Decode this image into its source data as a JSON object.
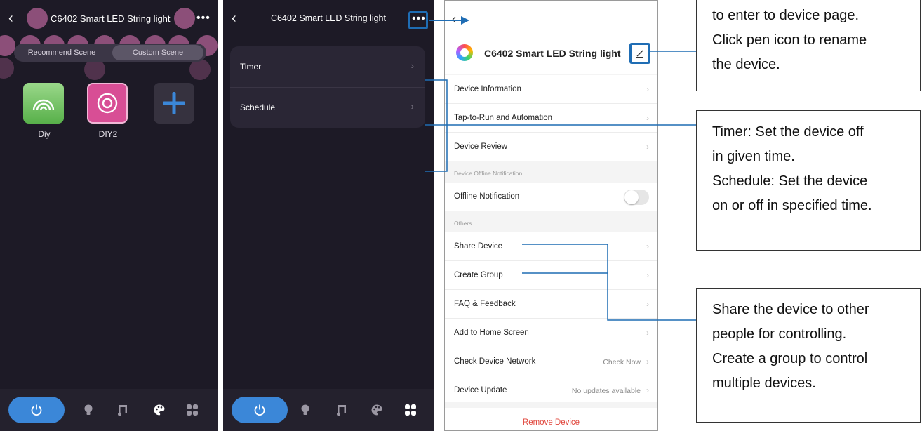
{
  "scene_screen": {
    "title": "C6402 Smart LED String light",
    "tabs": {
      "recommend": "Recommend Scene",
      "custom": "Custom Scene"
    },
    "scenes": [
      {
        "name": "Diy",
        "icon": "rainbow-icon"
      },
      {
        "name": "DIY2",
        "icon": "target-icon"
      }
    ],
    "add_icon": "plus-icon",
    "bottom_tabs": [
      "power-icon",
      "bulb-icon",
      "music-icon",
      "palette-icon",
      "grid-icon"
    ],
    "active_tab": "power-icon"
  },
  "timer_screen": {
    "title": "C6402 Smart LED String light",
    "menu": [
      {
        "label": "Timer"
      },
      {
        "label": "Schedule"
      }
    ],
    "bottom_tabs": [
      "power-icon",
      "bulb-icon",
      "music-icon",
      "palette-icon",
      "grid-icon"
    ],
    "active_tab": "grid-icon"
  },
  "settings_screen": {
    "device_name": "C6402 Smart LED String light",
    "rows": {
      "device_information": "Device Information",
      "tap_to_run": "Tap-to-Run and Automation",
      "device_review": "Device Review",
      "offline_section": "Device Offline Notification",
      "offline_notification": "Offline Notification",
      "offline_toggle_on": false,
      "others_section": "Others",
      "share_device": "Share Device",
      "create_group": "Create Group",
      "faq": "FAQ & Feedback",
      "add_home": "Add to Home Screen",
      "check_network": "Check Device Network",
      "check_network_value": "Check Now",
      "device_update": "Device Update",
      "device_update_value": "No updates available",
      "remove_device": "Remove Device"
    }
  },
  "callouts": {
    "c1": [
      "to enter to device page.",
      "Click pen icon to rename",
      "the device."
    ],
    "c2": [
      "Timer: Set the device off",
      "in given time.",
      "Schedule: Set the device",
      "on or off in specified time."
    ],
    "c3": [
      "Share the device to other",
      "people for controlling.",
      "Create a group to control",
      "multiple devices."
    ]
  },
  "colors": {
    "dark_bg": "#1d1a26",
    "accent_blue": "#3b87d8",
    "annotation_blue": "#1f6db4",
    "bubble_pink": "#b26196",
    "remove_red": "#e0453b"
  }
}
